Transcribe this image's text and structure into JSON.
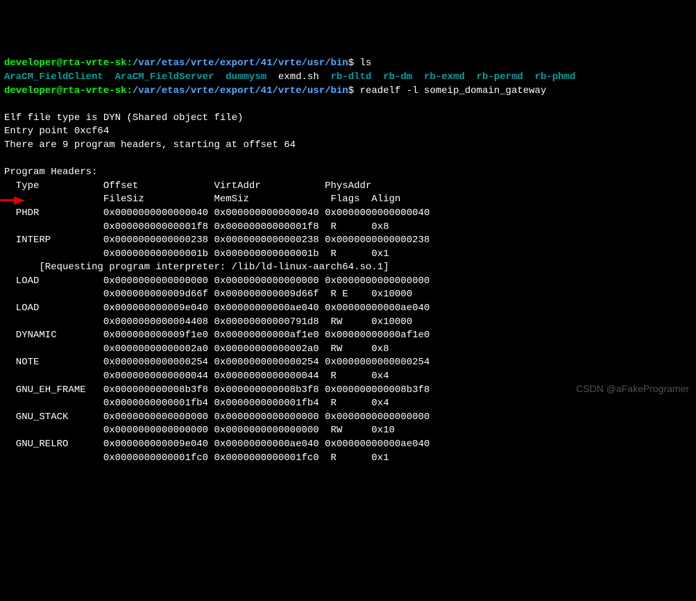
{
  "prompt1": {
    "user": "developer@rta-vrte-sk",
    "colon": ":",
    "path": "/var/etas/vrte/export/41/vrte/usr/bin",
    "dollar": "$ ",
    "cmd": "ls"
  },
  "ls": {
    "items": [
      {
        "name": "AraCM_FieldClient",
        "cls": "exe"
      },
      {
        "name": "AraCM_FieldServer",
        "cls": "exe"
      },
      {
        "name": "dummysm",
        "cls": "exe"
      },
      {
        "name": "exmd.sh",
        "cls": "file-plain"
      },
      {
        "name": "rb-dltd",
        "cls": "exe"
      },
      {
        "name": "rb-dm",
        "cls": "exe"
      },
      {
        "name": "rb-exmd",
        "cls": "exe"
      },
      {
        "name": "rb-permd",
        "cls": "exe"
      },
      {
        "name": "rb-phmd",
        "cls": "exe"
      }
    ]
  },
  "prompt2": {
    "user": "developer@rta-vrte-sk",
    "colon": ":",
    "path": "/var/etas/vrte/export/41/vrte/usr/bin",
    "dollar": "$ ",
    "cmd": "readelf -l someip_domain_gateway"
  },
  "elf": {
    "type_line": "Elf file type is DYN (Shared object file)",
    "entry_line": "Entry point 0xcf64",
    "count_line": "There are 9 program headers, starting at offset 64",
    "hdr_title": "Program Headers:",
    "hdr1": "  Type           Offset             VirtAddr           PhysAddr",
    "hdr2": "                 FileSiz            MemSiz              Flags  Align",
    "rows": [
      "  PHDR           0x0000000000000040 0x0000000000000040 0x0000000000000040",
      "                 0x00000000000001f8 0x00000000000001f8  R      0x8",
      "  INTERP         0x0000000000000238 0x0000000000000238 0x0000000000000238",
      "                 0x000000000000001b 0x000000000000001b  R      0x1",
      "      [Requesting program interpreter: /lib/ld-linux-aarch64.so.1]",
      "  LOAD           0x0000000000000000 0x0000000000000000 0x0000000000000000",
      "                 0x000000000009d66f 0x000000000009d66f  R E    0x10000",
      "  LOAD           0x000000000009e040 0x00000000000ae040 0x00000000000ae040",
      "                 0x0000000000004408 0x00000000000791d8  RW     0x10000",
      "  DYNAMIC        0x000000000009f1e0 0x00000000000af1e0 0x00000000000af1e0",
      "                 0x00000000000002a0 0x00000000000002a0  RW     0x8",
      "  NOTE           0x0000000000000254 0x0000000000000254 0x0000000000000254",
      "                 0x0000000000000044 0x0000000000000044  R      0x4",
      "  GNU_EH_FRAME   0x000000000008b3f8 0x000000000008b3f8 0x000000000008b3f8",
      "                 0x0000000000001fb4 0x0000000000001fb4  R      0x4",
      "  GNU_STACK      0x0000000000000000 0x0000000000000000 0x0000000000000000",
      "                 0x0000000000000000 0x0000000000000000  RW     0x10",
      "  GNU_RELRO      0x000000000009e040 0x00000000000ae040 0x00000000000ae040",
      "                 0x0000000000001fc0 0x0000000000001fc0  R      0x1"
    ]
  },
  "watermark": "CSDN @aFakeProgramer"
}
